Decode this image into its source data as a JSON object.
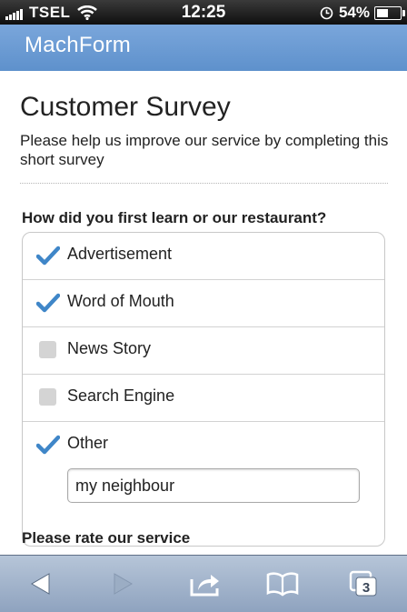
{
  "status_bar": {
    "carrier": "TSEL",
    "time": "12:25",
    "battery_percent": "54%",
    "battery_level": 0.54
  },
  "header": {
    "logo": "MachForm"
  },
  "form": {
    "title": "Customer Survey",
    "description": "Please help us improve our service by completing this short survey",
    "question1": {
      "label": "How did you first learn or our restaurant?",
      "options": [
        {
          "label": "Advertisement",
          "checked": true
        },
        {
          "label": "Word of Mouth",
          "checked": true
        },
        {
          "label": "News Story",
          "checked": false
        },
        {
          "label": "Search Engine",
          "checked": false
        },
        {
          "label": "Other",
          "checked": true
        }
      ],
      "other_value": "my neighbour"
    },
    "question2": {
      "label": "Please rate our service"
    }
  },
  "toolbar": {
    "tabs_count": "3"
  },
  "colors": {
    "header": "#6b9bd1",
    "check": "#3f86c8",
    "toolbar": "#a3b4cb"
  }
}
